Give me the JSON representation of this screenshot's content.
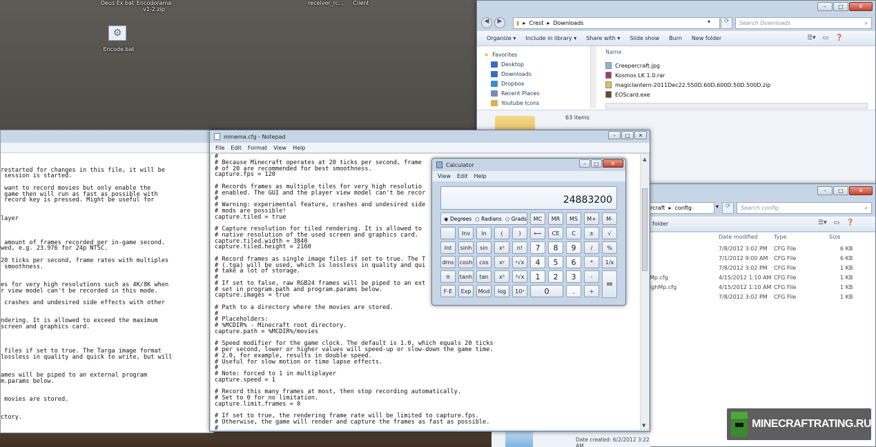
{
  "desktop": {
    "icons": [
      {
        "label": "Deus Ex.bat"
      },
      {
        "label": "Encodorama v1-2.zip"
      },
      {
        "label": "Encode.bat"
      },
      {
        "label": "receiver_rc..."
      },
      {
        "label": "Client"
      }
    ],
    "watermark": "MINECRAFTRATING.RU"
  },
  "bg_editor": {
    "lines": [
      "",
      "",
      "restarted for changes in this file, it will be",
      " session is started.",
      "",
      " want to record movies but only enable the",
      " game then will run as fast as possible with",
      " record key is pressed. Might be useful for",
      "",
      "",
      "layer",
      "",
      "",
      "",
      " amount of frames recorded per in-game second.",
      "wed, e.g. 23.976 for 24p NTSC.",
      "",
      "20 ticks per second, frame rates with multiples",
      " smoothness.",
      "",
      "",
      "es for very high resolutions such as 4K/8K when",
      "r view model can't be recorded in this mode.",
      "",
      " crashes and undesired side effects with other",
      "",
      "",
      "ndering. It is allowed to exceed the maximum",
      "screen and graphics card.",
      "",
      "",
      "",
      " files if set to true. The Targa image format",
      "lossless in quality and quick to write, but will",
      "",
      "",
      "ames will be piped to an external program",
      "m.params below.",
      "",
      "",
      " movies are stored.",
      "",
      "",
      "ctory."
    ]
  },
  "notepad": {
    "title": "minema.cfg - Notepad",
    "menu": [
      "File",
      "Edit",
      "Format",
      "View",
      "Help"
    ],
    "lines": [
      "#",
      "# Because Minecraft operates at 20 ticks per second, frame",
      "# of 20 are recommended for best smoothness.",
      "capture.fps = 120",
      "",
      "# Records frames as multiple tiles for very high resolutio",
      "# enabled. The GUI and the player view model can't be recor",
      "#",
      "# Warning: experimental feature, crashes and undesired side",
      "# mods are possible!",
      "capture.tiled = true",
      "",
      "# Capture resolution for tiled rendering. It is allowed to",
      "# native resolution of the used screen and graphics card.",
      "capture.tiled.width = 3840",
      "capture.tiled.height = 2160",
      "",
      "# Record frames as single image files if set to true. The T",
      "# (.tga) will be used, which is lossless in quality and qui",
      "# take a lot of storage.",
      "#",
      "# If set to false, raw RGB24 frames will be piped to an ext",
      "# set in program.path and program.params below.",
      "capture.images = true",
      "",
      "# Path to a directory where the movies are stored.",
      "#",
      "# Placeholders:",
      "# %MCDIR% - Minecraft root directory.",
      "capture.path = %MCDIR%/movies",
      "",
      "# Speed modifier for the game clock. The default is 1.0, which equals 20 ticks",
      "# per second, lower or higher values will speed-up or slow-down the game time.",
      "# 2.0, for example, results in double speed.",
      "# Useful for slow motion or time lapse effects.",
      "#",
      "# Note: forced to 1 in multiplayer",
      "capture.speed = 1",
      "",
      "# Record this many frames at most, then stop recording automatically.",
      "# Set to 0 for no limitation.",
      "capture.limit.frames = 0",
      "",
      "# If set to true, the rendering frame rate will be limited to capture.fps.",
      "# Otherwise, the game will render and capture the frames as fast as possible.",
      "#"
    ]
  },
  "explorer_downloads": {
    "breadcrumb": [
      "Crest",
      "Downloads"
    ],
    "search_placeholder": "Search Downloads",
    "toolbar": [
      "Organize",
      "Include in library",
      "Share with",
      "Slide show",
      "Burn",
      "New folder"
    ],
    "nav": [
      "Favorites",
      "Desktop",
      "Downloads",
      "Dropbox",
      "Recent Places",
      "Youtube Icons"
    ],
    "column_name": "Name",
    "files": [
      "Creepercraft.jpg",
      "Kosmos LK 1.0.rar",
      "magiclantern-2011Dec22.550D.60D.600D.50D.500D.zip",
      "EOScard.exe"
    ],
    "status": "63 items",
    "date_created": "Date created: 6/2/2012 3:22 AM"
  },
  "explorer_config": {
    "breadcrumb": [
      "rcraft",
      "config"
    ],
    "search_placeholder": "Search config",
    "left_label": "folder",
    "columns": [
      "Date modified",
      "Type",
      "Size"
    ],
    "rows": [
      {
        "name": "",
        "date": "7/8/2012 3:02 PM",
        "type": "CFG File",
        "size": "6 KB"
      },
      {
        "name": "",
        "date": "7/1/2012 9:00 AM",
        "type": "CFG File",
        "size": "6 KB"
      },
      {
        "name": "",
        "date": "7/8/2012 3:02 PM",
        "type": "CFG File",
        "size": "1 KB"
      },
      {
        "name": "Mp.cfg",
        "date": "4/15/2012 1:10 AM",
        "type": "CFG File",
        "size": "1 KB"
      },
      {
        "name": "ighMp.cfg",
        "date": "4/15/2012 1:10 AM",
        "type": "CFG File",
        "size": "1 KB"
      },
      {
        "name": "",
        "date": "7/8/2012 3:02 PM",
        "type": "CFG File",
        "size": "1 KB"
      }
    ]
  },
  "calculator": {
    "title": "Calculator",
    "menu": [
      "View",
      "Edit",
      "Help"
    ],
    "display": "24883200",
    "modes": [
      "Degrees",
      "Radians",
      "Grads"
    ],
    "mem": [
      "MC",
      "MR",
      "MS",
      "M+",
      "M-"
    ],
    "row2": [
      "",
      "Inv",
      "ln",
      "(",
      ")",
      "⟵",
      "CE",
      "C",
      "±",
      "√"
    ],
    "row3": [
      "Int",
      "sinh",
      "sin",
      "x²",
      "n!",
      "7",
      "8",
      "9",
      "/",
      "%"
    ],
    "row4": [
      "dms",
      "cosh",
      "cos",
      "xʸ",
      "ʸ√x",
      "4",
      "5",
      "6",
      "*",
      "1/x"
    ],
    "row5": [
      "π",
      "tanh",
      "tan",
      "x³",
      "³√x",
      "1",
      "2",
      "3",
      "-",
      "="
    ],
    "row6": [
      "F-E",
      "Exp",
      "Mod",
      "log",
      "10ˣ",
      "0",
      ".",
      "+"
    ]
  }
}
